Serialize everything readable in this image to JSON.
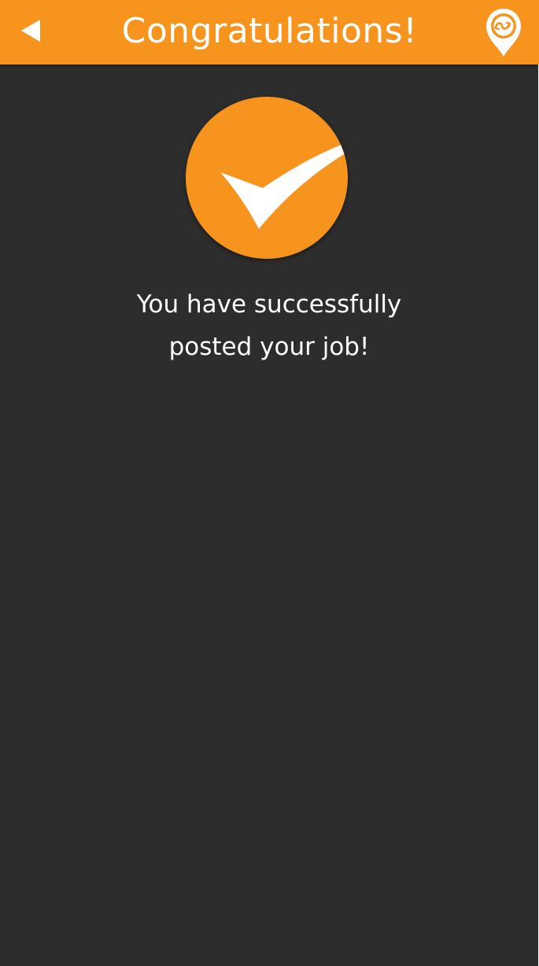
{
  "header": {
    "title": "Congratulations!",
    "back_icon": "back-arrow-icon",
    "logo_icon": "location-pin-logo-icon"
  },
  "success": {
    "icon": "checkmark-icon",
    "message_line1": "You have successfully",
    "message_line2": "posted your job!"
  },
  "colors": {
    "accent": "#f7941d",
    "background": "#2d2d2d",
    "text": "#ffffff"
  }
}
